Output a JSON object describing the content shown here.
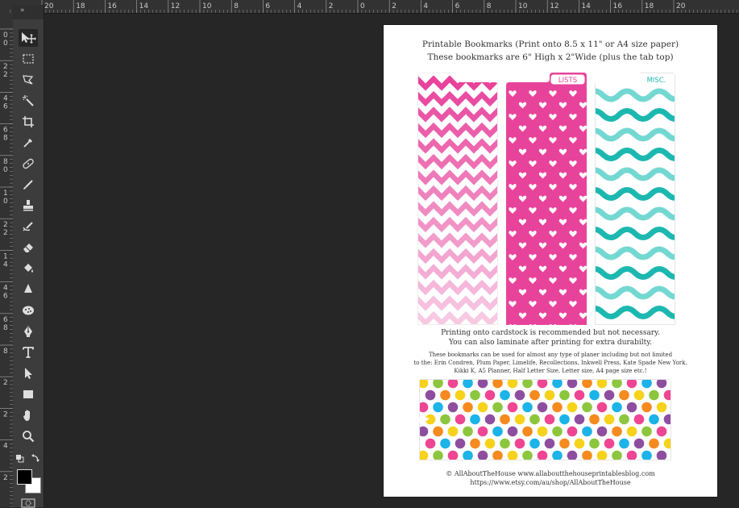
{
  "ruler": {
    "h_labels": [
      "20",
      "18",
      "16",
      "14",
      "12",
      "10",
      "8",
      "6",
      "4",
      "2",
      "0",
      "2",
      "4",
      "6",
      "8",
      "10",
      "12",
      "14",
      "16",
      "18",
      "20"
    ],
    "v_labels": [
      "0",
      "2",
      "4",
      "6",
      "8",
      "1",
      "2",
      "1",
      "4",
      "6",
      "8",
      "2",
      "2",
      "4",
      "2"
    ],
    "v_labels_secondary": [
      "0",
      "2",
      "6",
      "8",
      "0",
      "0",
      "2",
      "4",
      "6",
      "8"
    ]
  },
  "toolbar": {
    "collapse_label": "»",
    "tools": [
      {
        "name": "move-tool",
        "icon": "move-icon"
      },
      {
        "name": "marquee-tool",
        "icon": "marquee-icon"
      },
      {
        "name": "lasso-tool",
        "icon": "lasso-icon"
      },
      {
        "name": "magic-wand-tool",
        "icon": "magic-wand-icon"
      },
      {
        "name": "crop-tool",
        "icon": "crop-icon"
      },
      {
        "name": "eyedropper-tool",
        "icon": "eyedropper-icon"
      },
      {
        "name": "healing-brush-tool",
        "icon": "bandage-icon"
      },
      {
        "name": "brush-tool",
        "icon": "brush-icon"
      },
      {
        "name": "clone-stamp-tool",
        "icon": "stamp-icon"
      },
      {
        "name": "history-brush-tool",
        "icon": "history-brush-icon"
      },
      {
        "name": "eraser-tool",
        "icon": "eraser-icon"
      },
      {
        "name": "paint-bucket-tool",
        "icon": "bucket-icon"
      },
      {
        "name": "blur-tool",
        "icon": "blur-icon"
      },
      {
        "name": "sponge-tool",
        "icon": "sponge-icon"
      },
      {
        "name": "pen-tool",
        "icon": "pen-icon"
      },
      {
        "name": "type-tool",
        "icon": "type-icon"
      },
      {
        "name": "path-selection-tool",
        "icon": "pointer-icon"
      },
      {
        "name": "shape-tool",
        "icon": "rectangle-icon"
      },
      {
        "name": "hand-tool",
        "icon": "hand-icon"
      },
      {
        "name": "zoom-tool",
        "icon": "zoom-icon"
      }
    ],
    "foreground_color": "#000000",
    "background_color": "#ffffff"
  },
  "document": {
    "title_line1": "Printable Bookmarks (Print onto 8.5 x 11\" or A4 size paper)",
    "title_line2": "These bookmarks are 6\"  High  x 2\"Wide (plus the tab top)",
    "tab_lists": "LISTS",
    "tab_misc": "MISC.",
    "caption_line1": "Printing onto cardstock is recommended but not necessary.",
    "caption_line2": "You can also laminate after printing for extra durabilty.",
    "body_line1": "These bookmarks can be used for almost any type of planer including but not limited",
    "body_line2": "to the: Erin Condren, Plum Paper, Limelife, Recollections, Inkwell Press, Kate Spade New York,",
    "body_line3": "Kikki K, A5 Planner, Half Letter Size, Letter size, A4 page size etc.!",
    "footer_line1": "© AllAboutTheHouse    www.allaboutthehouseprintablesblog.com",
    "footer_line2": "https://www.etsy.com/au/shop/AllAboutTheHouse"
  },
  "colors": {
    "pink": "#e8439b",
    "light_pink": "#f48fc8",
    "teal": "#1cb8b0",
    "light_teal": "#74d8d2",
    "polka": [
      "#f6d21a",
      "#8cc63e",
      "#ee4693",
      "#1bb3e8",
      "#8e4ea0",
      "#f58a1f"
    ]
  }
}
